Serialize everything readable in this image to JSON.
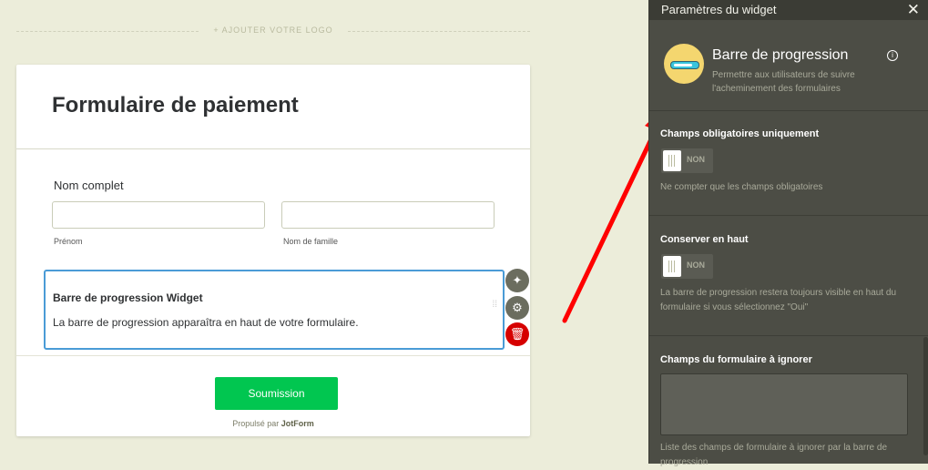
{
  "canvas": {
    "logo_placeholder": "+ AJOUTER VOTRE LOGO"
  },
  "form": {
    "title": "Formulaire de paiement",
    "full_name_label": "Nom complet",
    "first_name_sublabel": "Prénom",
    "last_name_sublabel": "Nom de famille",
    "first_name_value": "",
    "last_name_value": "",
    "widget_title": "Barre de progression Widget",
    "widget_description": "La barre de progression apparaîtra en haut de votre formulaire.",
    "submit_label": "Soumission",
    "powered_prefix": "Propulsé par",
    "powered_brand": "JotForm"
  },
  "panel": {
    "title": "Paramètres du widget",
    "widget_name": "Barre de progression",
    "widget_subtitle": "Permettre aux utilisateurs de suivre l'acheminement des formulaires",
    "sections": [
      {
        "title": "Champs obligatoires uniquement",
        "toggle": "NON",
        "help": "Ne compter que les champs obligatoires"
      },
      {
        "title": "Conserver en haut",
        "toggle": "NON",
        "help": "La barre de progression restera toujours visible en haut du formulaire si vous sélectionnez \"Oui\""
      },
      {
        "title": "Champs du formulaire à ignorer",
        "value": "",
        "help": "Liste des champs de formulaire à ignorer par la barre de progression"
      }
    ]
  },
  "icons": {
    "close": "close-icon",
    "info": "info-icon",
    "wand": "magic-wand-icon",
    "gear": "gear-icon",
    "trash": "trash-icon",
    "widget": "progress-bar-icon"
  },
  "colors": {
    "background": "#ecedda",
    "panel": "#4c4d45",
    "submit": "#01c650",
    "delete": "#d60000",
    "selection": "#4a9bd6",
    "arrow": "#ff0000"
  }
}
